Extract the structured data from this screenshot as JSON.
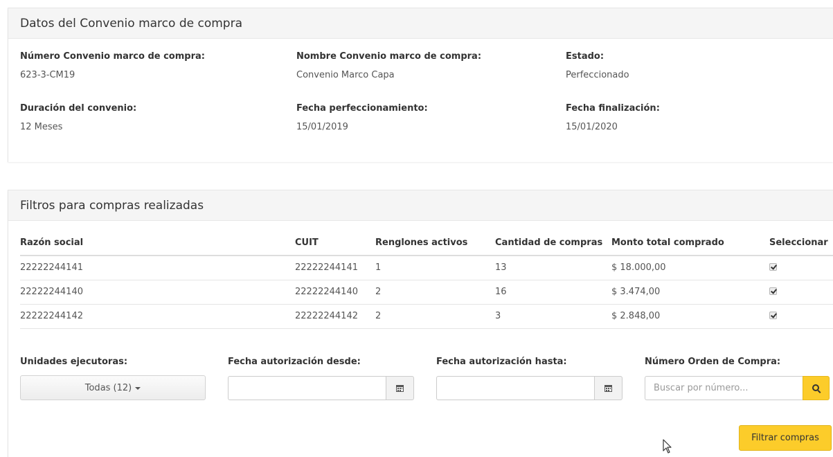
{
  "convenio": {
    "title": "Datos del Convenio marco de compra",
    "numero_label": "Número Convenio marco de compra:",
    "numero_value": "623-3-CM19",
    "nombre_label": "Nombre Convenio marco de compra:",
    "nombre_value": "Convenio Marco Capa",
    "estado_label": "Estado:",
    "estado_value": "Perfeccionado",
    "duracion_label": "Duración del convenio:",
    "duracion_value": "12 Meses",
    "fecha_perf_label": "Fecha perfeccionamiento:",
    "fecha_perf_value": "15/01/2019",
    "fecha_fin_label": "Fecha finalización:",
    "fecha_fin_value": "15/01/2020"
  },
  "filtros": {
    "title": "Filtros para compras realizadas",
    "columns": [
      "Razón social",
      "CUIT",
      "Renglones activos",
      "Cantidad de compras",
      "Monto total comprado",
      "Seleccionar"
    ],
    "rows": [
      {
        "razon": "22222244141",
        "cuit": "22222244141",
        "renglones": "1",
        "cantidad": "13",
        "monto": "$ 18.000,00",
        "selected": true
      },
      {
        "razon": "22222244140",
        "cuit": "22222244140",
        "renglones": "2",
        "cantidad": "16",
        "monto": "$ 3.474,00",
        "selected": true
      },
      {
        "razon": "22222244142",
        "cuit": "22222244142",
        "renglones": "2",
        "cantidad": "3",
        "monto": "$ 2.848,00",
        "selected": true
      }
    ],
    "unidades_label": "Unidades ejecutoras:",
    "unidades_value": "Todas (12)",
    "fecha_desde_label": "Fecha autorización desde:",
    "fecha_hasta_label": "Fecha autorización hasta:",
    "orden_label": "Número Orden de Compra:",
    "orden_placeholder": "Buscar por número...",
    "filtrar_label": "Filtrar compras"
  },
  "colors": {
    "accent": "#fccc2a",
    "heading_bg": "#f5f5f5"
  },
  "icons": [
    "calendar-icon",
    "search-icon",
    "caret-down-icon",
    "checkbox-checked-icon",
    "mouse-cursor-icon"
  ]
}
